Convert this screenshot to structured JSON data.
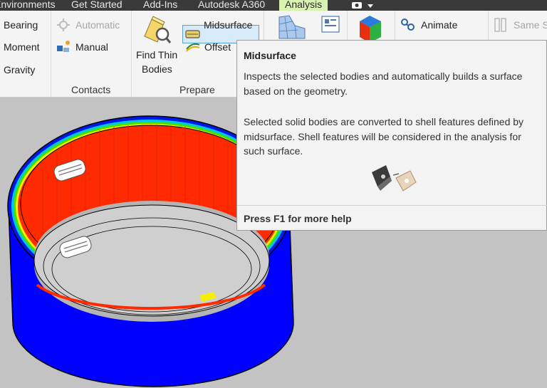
{
  "tabs": [
    {
      "label": "Environments",
      "active": false
    },
    {
      "label": "Get Started",
      "active": false
    },
    {
      "label": "Add-Ins",
      "active": false
    },
    {
      "label": "Autodesk A360",
      "active": false
    },
    {
      "label": "Analysis",
      "active": true
    }
  ],
  "ribbon": {
    "loads": {
      "items": [
        "Bearing",
        "Moment",
        "Gravity"
      ]
    },
    "contacts": {
      "automatic": "Automatic",
      "manual": "Manual",
      "panel_label": "Contacts"
    },
    "prepare": {
      "find_thin_bodies_line1": "Find Thin",
      "find_thin_bodies_line2": "Bodies",
      "midsurface": "Midsurface",
      "offset": "Offset",
      "panel_label": "Prepare"
    },
    "result": {
      "animate": "Animate",
      "same_scale": "Same S"
    }
  },
  "tooltip": {
    "title": "Midsurface",
    "paragraph1": "Inspects the selected bodies and automatically builds a surface based on the geometry.",
    "paragraph2": "Selected solid bodies are converted to shell features defined by midsurface. Shell features will be considered in the analysis for such surface.",
    "footer": "Press F1 for more help"
  },
  "colors": {
    "accent_tab": "#d8f2b0",
    "highlight_border": "#5aa0d6",
    "stress_high": "#ff2a00",
    "stress_low": "#0000ff"
  }
}
